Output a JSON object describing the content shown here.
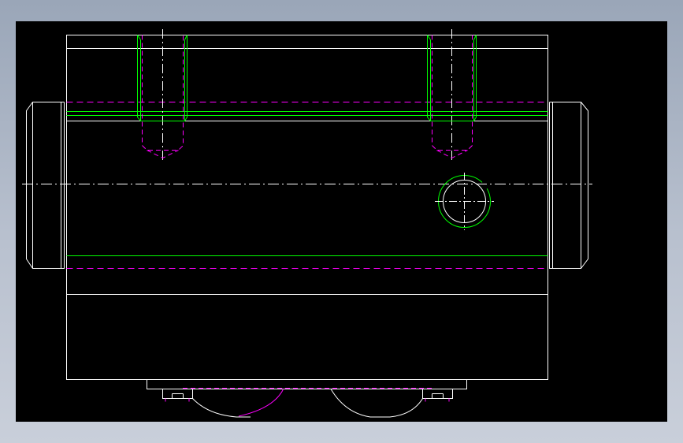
{
  "viewport": {
    "background": "#000000",
    "frame_color": "#a9b3c4"
  },
  "layers": {
    "outline": {
      "color": "#ffffff",
      "linetype": "continuous"
    },
    "hidden": {
      "color": "#ff00ff",
      "linetype": "dashed"
    },
    "thread": {
      "color": "#00ff00",
      "linetype": "continuous"
    },
    "center": {
      "color": "#ffffff",
      "linetype": "dash-dot"
    }
  },
  "content": {
    "view": "front-view",
    "text_labels": []
  }
}
